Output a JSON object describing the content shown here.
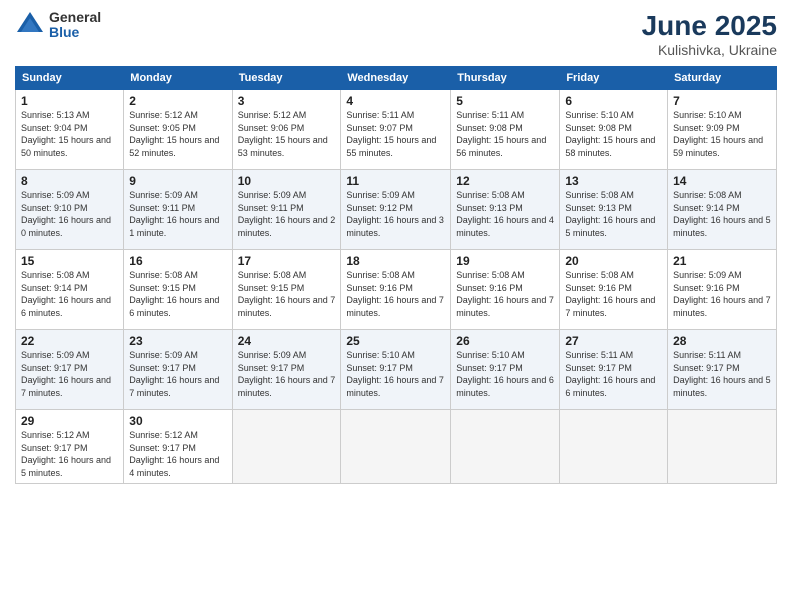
{
  "logo": {
    "general": "General",
    "blue": "Blue"
  },
  "title": {
    "month": "June 2025",
    "location": "Kulishivka, Ukraine"
  },
  "headers": [
    "Sunday",
    "Monday",
    "Tuesday",
    "Wednesday",
    "Thursday",
    "Friday",
    "Saturday"
  ],
  "weeks": [
    [
      {
        "day": "1",
        "sunrise": "Sunrise: 5:13 AM",
        "sunset": "Sunset: 9:04 PM",
        "daylight": "Daylight: 15 hours and 50 minutes."
      },
      {
        "day": "2",
        "sunrise": "Sunrise: 5:12 AM",
        "sunset": "Sunset: 9:05 PM",
        "daylight": "Daylight: 15 hours and 52 minutes."
      },
      {
        "day": "3",
        "sunrise": "Sunrise: 5:12 AM",
        "sunset": "Sunset: 9:06 PM",
        "daylight": "Daylight: 15 hours and 53 minutes."
      },
      {
        "day": "4",
        "sunrise": "Sunrise: 5:11 AM",
        "sunset": "Sunset: 9:07 PM",
        "daylight": "Daylight: 15 hours and 55 minutes."
      },
      {
        "day": "5",
        "sunrise": "Sunrise: 5:11 AM",
        "sunset": "Sunset: 9:08 PM",
        "daylight": "Daylight: 15 hours and 56 minutes."
      },
      {
        "day": "6",
        "sunrise": "Sunrise: 5:10 AM",
        "sunset": "Sunset: 9:08 PM",
        "daylight": "Daylight: 15 hours and 58 minutes."
      },
      {
        "day": "7",
        "sunrise": "Sunrise: 5:10 AM",
        "sunset": "Sunset: 9:09 PM",
        "daylight": "Daylight: 15 hours and 59 minutes."
      }
    ],
    [
      {
        "day": "8",
        "sunrise": "Sunrise: 5:09 AM",
        "sunset": "Sunset: 9:10 PM",
        "daylight": "Daylight: 16 hours and 0 minutes."
      },
      {
        "day": "9",
        "sunrise": "Sunrise: 5:09 AM",
        "sunset": "Sunset: 9:11 PM",
        "daylight": "Daylight: 16 hours and 1 minute."
      },
      {
        "day": "10",
        "sunrise": "Sunrise: 5:09 AM",
        "sunset": "Sunset: 9:11 PM",
        "daylight": "Daylight: 16 hours and 2 minutes."
      },
      {
        "day": "11",
        "sunrise": "Sunrise: 5:09 AM",
        "sunset": "Sunset: 9:12 PM",
        "daylight": "Daylight: 16 hours and 3 minutes."
      },
      {
        "day": "12",
        "sunrise": "Sunrise: 5:08 AM",
        "sunset": "Sunset: 9:13 PM",
        "daylight": "Daylight: 16 hours and 4 minutes."
      },
      {
        "day": "13",
        "sunrise": "Sunrise: 5:08 AM",
        "sunset": "Sunset: 9:13 PM",
        "daylight": "Daylight: 16 hours and 5 minutes."
      },
      {
        "day": "14",
        "sunrise": "Sunrise: 5:08 AM",
        "sunset": "Sunset: 9:14 PM",
        "daylight": "Daylight: 16 hours and 5 minutes."
      }
    ],
    [
      {
        "day": "15",
        "sunrise": "Sunrise: 5:08 AM",
        "sunset": "Sunset: 9:14 PM",
        "daylight": "Daylight: 16 hours and 6 minutes."
      },
      {
        "day": "16",
        "sunrise": "Sunrise: 5:08 AM",
        "sunset": "Sunset: 9:15 PM",
        "daylight": "Daylight: 16 hours and 6 minutes."
      },
      {
        "day": "17",
        "sunrise": "Sunrise: 5:08 AM",
        "sunset": "Sunset: 9:15 PM",
        "daylight": "Daylight: 16 hours and 7 minutes."
      },
      {
        "day": "18",
        "sunrise": "Sunrise: 5:08 AM",
        "sunset": "Sunset: 9:16 PM",
        "daylight": "Daylight: 16 hours and 7 minutes."
      },
      {
        "day": "19",
        "sunrise": "Sunrise: 5:08 AM",
        "sunset": "Sunset: 9:16 PM",
        "daylight": "Daylight: 16 hours and 7 minutes."
      },
      {
        "day": "20",
        "sunrise": "Sunrise: 5:08 AM",
        "sunset": "Sunset: 9:16 PM",
        "daylight": "Daylight: 16 hours and 7 minutes."
      },
      {
        "day": "21",
        "sunrise": "Sunrise: 5:09 AM",
        "sunset": "Sunset: 9:16 PM",
        "daylight": "Daylight: 16 hours and 7 minutes."
      }
    ],
    [
      {
        "day": "22",
        "sunrise": "Sunrise: 5:09 AM",
        "sunset": "Sunset: 9:17 PM",
        "daylight": "Daylight: 16 hours and 7 minutes."
      },
      {
        "day": "23",
        "sunrise": "Sunrise: 5:09 AM",
        "sunset": "Sunset: 9:17 PM",
        "daylight": "Daylight: 16 hours and 7 minutes."
      },
      {
        "day": "24",
        "sunrise": "Sunrise: 5:09 AM",
        "sunset": "Sunset: 9:17 PM",
        "daylight": "Daylight: 16 hours and 7 minutes."
      },
      {
        "day": "25",
        "sunrise": "Sunrise: 5:10 AM",
        "sunset": "Sunset: 9:17 PM",
        "daylight": "Daylight: 16 hours and 7 minutes."
      },
      {
        "day": "26",
        "sunrise": "Sunrise: 5:10 AM",
        "sunset": "Sunset: 9:17 PM",
        "daylight": "Daylight: 16 hours and 6 minutes."
      },
      {
        "day": "27",
        "sunrise": "Sunrise: 5:11 AM",
        "sunset": "Sunset: 9:17 PM",
        "daylight": "Daylight: 16 hours and 6 minutes."
      },
      {
        "day": "28",
        "sunrise": "Sunrise: 5:11 AM",
        "sunset": "Sunset: 9:17 PM",
        "daylight": "Daylight: 16 hours and 5 minutes."
      }
    ],
    [
      {
        "day": "29",
        "sunrise": "Sunrise: 5:12 AM",
        "sunset": "Sunset: 9:17 PM",
        "daylight": "Daylight: 16 hours and 5 minutes."
      },
      {
        "day": "30",
        "sunrise": "Sunrise: 5:12 AM",
        "sunset": "Sunset: 9:17 PM",
        "daylight": "Daylight: 16 hours and 4 minutes."
      },
      null,
      null,
      null,
      null,
      null
    ]
  ]
}
